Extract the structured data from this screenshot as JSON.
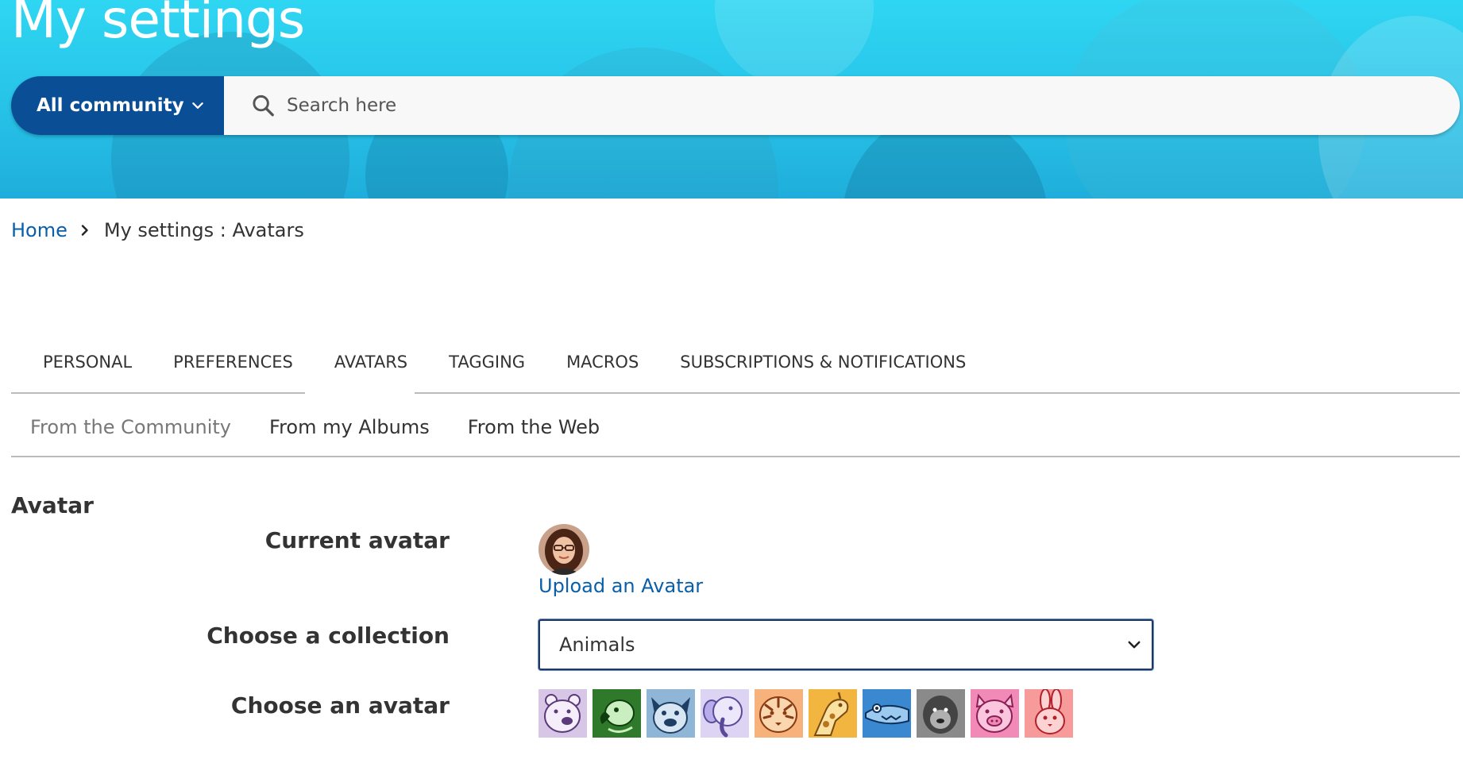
{
  "header": {
    "title": "My settings"
  },
  "search": {
    "scope_label": "All community",
    "placeholder": "Search here"
  },
  "breadcrumb": {
    "home": "Home",
    "current": "My settings : Avatars"
  },
  "tabs": [
    {
      "label": "PERSONAL"
    },
    {
      "label": "PREFERENCES"
    },
    {
      "label": "AVATARS",
      "active": true
    },
    {
      "label": "TAGGING"
    },
    {
      "label": "MACROS"
    },
    {
      "label": "SUBSCRIPTIONS & NOTIFICATIONS"
    }
  ],
  "subtabs": [
    {
      "label": "From the Community",
      "active": true
    },
    {
      "label": "From my Albums"
    },
    {
      "label": "From the Web"
    }
  ],
  "avatar_section": {
    "title": "Avatar",
    "current_label": "Current avatar",
    "upload_link": "Upload an Avatar",
    "collection_label": "Choose a collection",
    "collection_value": "Animals",
    "choose_label": "Choose an avatar",
    "avatars": [
      {
        "icon": "polar-bear-icon",
        "bg": "#d8c6e6",
        "fg": "#5a3a7a"
      },
      {
        "icon": "parrot-icon",
        "bg": "#2e7a2a",
        "fg": "#c9efc0"
      },
      {
        "icon": "bulldog-icon",
        "bg": "#8fb6d6",
        "fg": "#1e3f63"
      },
      {
        "icon": "elephant-icon",
        "bg": "#dcd4f2",
        "fg": "#5b4a9a"
      },
      {
        "icon": "tiger-icon",
        "bg": "#f6b27a",
        "fg": "#8a3b12"
      },
      {
        "icon": "giraffe-icon",
        "bg": "#f2b640",
        "fg": "#7a4a10"
      },
      {
        "icon": "crocodile-icon",
        "bg": "#3a88d0",
        "fg": "#0e2f58"
      },
      {
        "icon": "gorilla-icon",
        "bg": "#8a8a8a",
        "fg": "#222222"
      },
      {
        "icon": "pig-icon",
        "bg": "#f28ab8",
        "fg": "#8a1f55"
      },
      {
        "icon": "rabbit-icon",
        "bg": "#f69a9a",
        "fg": "#b31f2a"
      }
    ]
  },
  "colors": {
    "brand_blue": "#0a4f96",
    "link_blue": "#0a5fa8",
    "hero_cyan": "#2fd6f2"
  }
}
